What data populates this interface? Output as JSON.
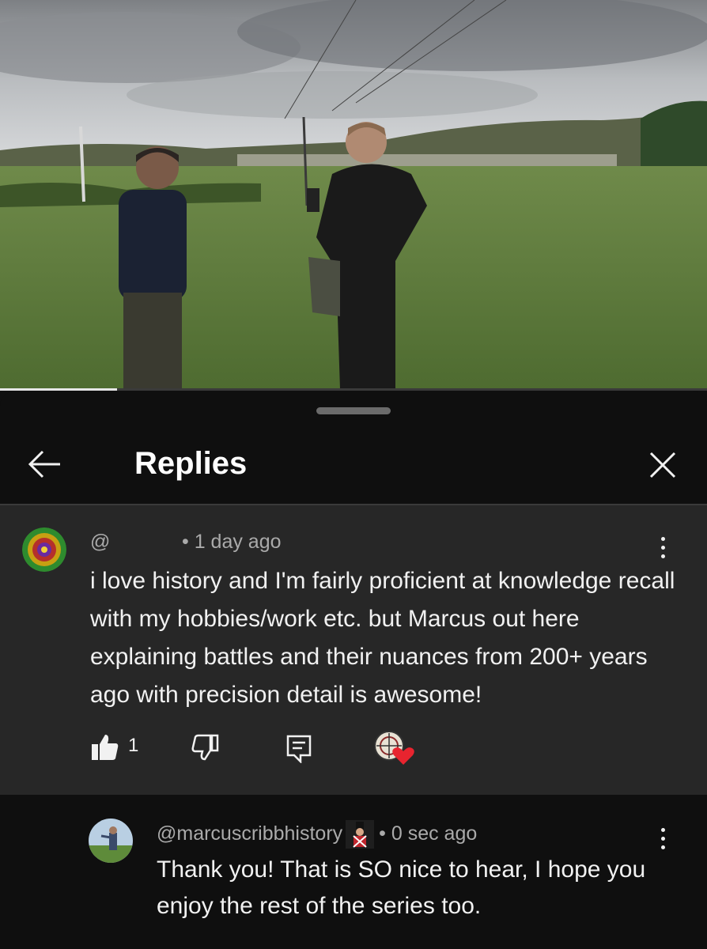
{
  "video": {
    "progress_fraction": 0.165
  },
  "sheet": {
    "title": "Replies",
    "back_icon": "arrow-left-icon",
    "close_icon": "close-icon"
  },
  "parent_comment": {
    "handle": "@",
    "time": "• 1 day ago",
    "text": "i love history and I'm fairly proficient at knowledge recall with my hobbies/work etc. but Marcus out here explaining battles and their nuances from 200+ years ago with precision detail is awesome!",
    "like_count": "1",
    "icons": [
      "thumbs-up-icon",
      "thumbs-down-icon",
      "reply-icon",
      "creator-heart-icon",
      "more-vert-icon"
    ]
  },
  "reply_comment": {
    "handle": "@marcuscribbhistory",
    "time": "• 0 sec ago",
    "text": "Thank you! That is SO nice to hear, I hope you enjoy the rest of the series too.",
    "icons": [
      "channel-badge-icon",
      "more-vert-icon"
    ]
  }
}
